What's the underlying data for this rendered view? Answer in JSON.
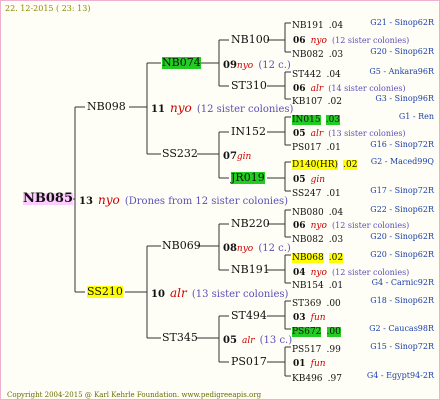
{
  "date_label": "22. 12-2015 ( 23: 13)",
  "footer": "Copyright 2004-2015 @ Karl Kehrle Foundation.   www.pedigreeapis.org",
  "root": {
    "name": "NB085",
    "year": "13",
    "breed": "nyo",
    "note": "(Drones from 12 sister colonies)"
  },
  "gen1": [
    {
      "name": "NB098",
      "year": "11",
      "breed": "nyo",
      "note": "(12 sister colonies)"
    },
    {
      "name": "SS210",
      "year": "10",
      "breed": "alr",
      "note": "(13 sister colonies)"
    }
  ],
  "gen2": [
    {
      "name": "NB074",
      "year": "09",
      "breed": "nyo",
      "note": "(12 c.)"
    },
    {
      "name": "SS232",
      "year": "07",
      "breed": "gin",
      "note": ""
    },
    {
      "name": "NB069",
      "year": "08",
      "breed": "nyo",
      "note": "(12 c.)"
    },
    {
      "name": "ST345",
      "year": "05",
      "breed": "alr",
      "note": "(13 c.)"
    }
  ],
  "gen3": [
    {
      "name": "NB100",
      "year": "06",
      "breed": "nyo",
      "note": "(12 sister colonies)"
    },
    {
      "name": "ST310",
      "year": "06",
      "breed": "alr",
      "note": "(14 sister colonies)"
    },
    {
      "name": "IN152",
      "year": "05",
      "breed": "alr",
      "note": "(13 sister colonies)"
    },
    {
      "name": "JR019",
      "year": "05",
      "breed": "gin",
      "note": ""
    },
    {
      "name": "NB220",
      "year": "06",
      "breed": "nyo",
      "note": "(12 sister colonies)"
    },
    {
      "name": "NB191",
      "year": "04",
      "breed": "nyo",
      "note": "(12 sister colonies)"
    },
    {
      "name": "ST494",
      "year": "03",
      "breed": "fun",
      "note": ""
    },
    {
      "name": "PS017",
      "year": "01",
      "breed": "fun",
      "note": ""
    }
  ],
  "gen4": [
    {
      "name": "NB191",
      "year": ".04",
      "loc": "G21 - Sinop62R"
    },
    {
      "name": "NB082",
      "year": ".03",
      "loc": "G20 - Sinop62R"
    },
    {
      "name": "ST442",
      "year": ".04",
      "loc": "G5 - Ankara96R"
    },
    {
      "name": "KB107",
      "year": ".02",
      "loc": "G3 - Sinop96R"
    },
    {
      "name": "IN015",
      "year": ".03",
      "loc": "G1 - Ren"
    },
    {
      "name": "PS017",
      "year": ".01",
      "loc": "G16 - Sinop72R"
    },
    {
      "name": "D140(HR)",
      "year": ".02",
      "loc": "G2 - Maced99Q"
    },
    {
      "name": "SS247",
      "year": ".01",
      "loc": "G17 - Sinop72R"
    },
    {
      "name": "NB080",
      "year": ".04",
      "loc": "G22 - Sinop62R"
    },
    {
      "name": "NB082",
      "year": ".03",
      "loc": "G20 - Sinop62R"
    },
    {
      "name": "NB068",
      "year": ".02",
      "loc": "G20 - Sinop62R"
    },
    {
      "name": "NB154",
      "year": ".01",
      "loc": "G4 - Carnic92R"
    },
    {
      "name": "ST369",
      "year": ".00",
      "loc": "G18 - Sinop62R"
    },
    {
      "name": "PS672",
      "year": ".00",
      "loc": "G2 - Caucas98R"
    },
    {
      "name": "PS517",
      "year": ".99",
      "loc": "G15 - Sinop72R"
    },
    {
      "name": "KB496",
      "year": ".97",
      "loc": "G4 - Egypt94-2R"
    }
  ]
}
